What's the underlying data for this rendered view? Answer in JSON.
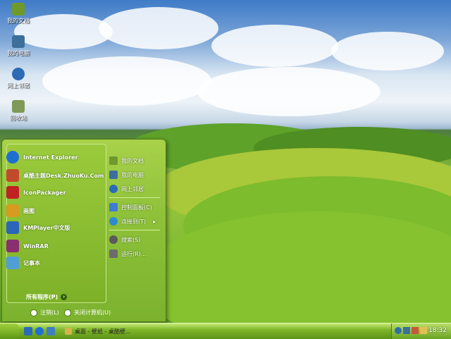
{
  "desktop_icons": [
    {
      "label": "我的文档",
      "color": "#6f9a2a"
    },
    {
      "label": "我的电脑",
      "color": "#3d6f9b"
    },
    {
      "label": "网上邻居",
      "color": "#2c6bb3"
    },
    {
      "label": "回收站",
      "color": "#7e9a56"
    }
  ],
  "start_menu": {
    "left_items": [
      {
        "label": "Internet Explorer",
        "icon": "internet-explorer-icon",
        "color": "#1f6fd1"
      },
      {
        "label": "桌酷主题Desk.ZhuoKu.Com",
        "icon": "zhuoku-icon",
        "color": "#c24a2b"
      },
      {
        "label": "IconPackager",
        "icon": "iconpackager-icon",
        "color": "#c02222"
      },
      {
        "label": "画图",
        "icon": "paint-icon",
        "color": "#d89a1f"
      },
      {
        "label": "KMPlayer中文版",
        "icon": "kmplayer-icon",
        "color": "#2b66b8"
      },
      {
        "label": "WinRAR",
        "icon": "winrar-icon",
        "color": "#8a2f6f"
      },
      {
        "label": "记事本",
        "icon": "notepad-icon",
        "color": "#4f9fd4"
      }
    ],
    "all_programs": "所有程序(P)",
    "right_items": [
      {
        "label": "我的文档",
        "icon": "my-documents-icon",
        "color": "#6f9a2a"
      },
      {
        "label": "我的电脑",
        "icon": "my-computer-icon",
        "color": "#3d6f9b"
      },
      {
        "label": "网上邻居",
        "icon": "network-icon",
        "color": "#2c6bb3"
      },
      {
        "label": "控制面板(C)",
        "icon": "control-panel-icon",
        "color": "#3f7ccf"
      },
      {
        "label": "连接到(T)",
        "icon": "connect-icon",
        "color": "#2e8ad0"
      },
      {
        "label": "搜索(S)",
        "icon": "search-icon",
        "color": "#5a5a5a"
      },
      {
        "label": "运行(R)...",
        "icon": "run-icon",
        "color": "#6b6b6b"
      }
    ],
    "logoff": "注销(L)",
    "shutdown": "关闭计算机(U)"
  },
  "taskbar": {
    "task_label": "桌面 - 壁纸 - 桌酷壁...",
    "clock": "18:32"
  }
}
